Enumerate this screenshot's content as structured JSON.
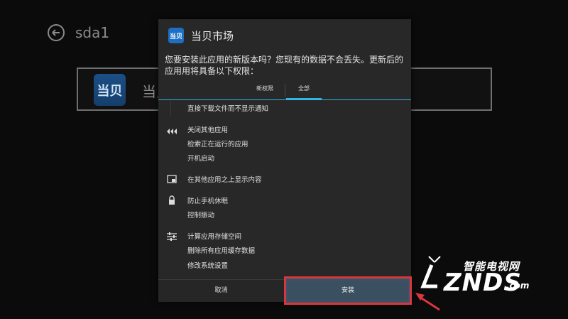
{
  "background": {
    "path": "sda1",
    "app_icon_text": "当贝",
    "app_name": "当贝"
  },
  "dialog": {
    "icon_text": "当贝",
    "title": "当贝市场",
    "message": "您要安装此应用的新版本吗？您现有的数据不会丢失。更新后的应用用将具备以下权限：",
    "tabs": [
      {
        "label": "新权限",
        "selected": false
      },
      {
        "label": "全部",
        "selected": true
      }
    ],
    "permissions": {
      "download": "直接下载文件而不显示通知",
      "close_apps": "关闭其他应用",
      "retrieve_apps": "检索正在运行的应用",
      "boot": "开机启动",
      "overlay": "在其他应用之上显示内容",
      "wakelock": "防止手机休眠",
      "vibrate": "控制振动",
      "storage": "计算应用存储空间",
      "clear_cache": "删除所有应用缓存数据",
      "settings": "修改系统设置"
    },
    "cancel_label": "取消",
    "install_label": "安装"
  },
  "watermark": {
    "subtitle": "智能电视网",
    "brand": "ZNDS",
    "suffix": ".com"
  },
  "colors": {
    "accent": "#33b5e5",
    "highlight_border": "#d9363e",
    "install_bg": "#3c5366"
  }
}
